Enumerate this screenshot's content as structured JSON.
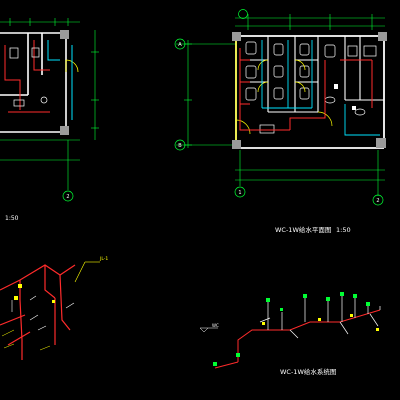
{
  "drawing": {
    "title_plan_right": "WC-1W给水平面图",
    "scale_plan_right": "1:50",
    "scale_plan_left": "1:50",
    "title_system_right": "WC-1W给水系统图",
    "grid_left": [
      "1",
      "2"
    ],
    "grid_right_top": [
      "1",
      "2"
    ],
    "grid_right_side": [
      "A",
      "B"
    ],
    "pipe_tag": "JL-1",
    "room_tag": "WC"
  },
  "colors": {
    "background": "#000000",
    "wall": "#ffffff",
    "water_pipe": "#ff2b2b",
    "drain_pipe": "#00e5ff",
    "fixture": "#ffffff",
    "dimension": "#00ff33",
    "door": "#ffff00",
    "hatch": "#a0a0a0"
  }
}
